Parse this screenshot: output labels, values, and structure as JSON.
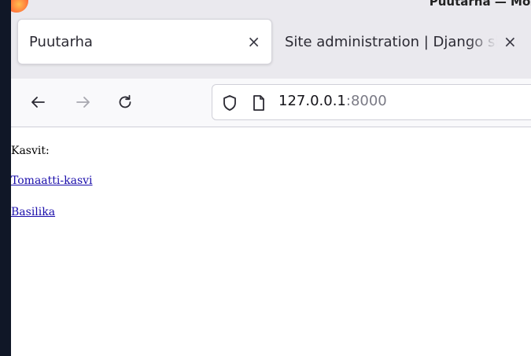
{
  "window": {
    "title": "Puutarha — Moz"
  },
  "tabs": [
    {
      "label": "Puutarha",
      "close": "×",
      "active": true
    },
    {
      "label": "Site administration | Django site admin",
      "close": "×",
      "active": false
    }
  ],
  "nav": {
    "back": "back-arrow",
    "forward": "forward-arrow",
    "reload": "reload"
  },
  "url": {
    "host": "127.0.0.1",
    "port": ":8000"
  },
  "page": {
    "heading": "Kasvit:",
    "plants": [
      "Tomaatti-kasvi",
      "Basilika"
    ]
  },
  "colors": {
    "link": "#1a0dab",
    "accent": "#ff7139"
  }
}
